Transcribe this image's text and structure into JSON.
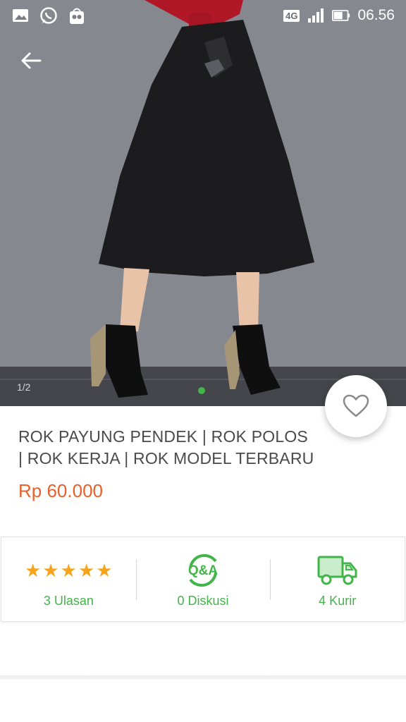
{
  "status_bar": {
    "time": "06.56",
    "network": "4G",
    "icons": [
      "gallery-icon",
      "whatsapp-icon",
      "tokopedia-icon",
      "signal-icon",
      "battery-icon"
    ]
  },
  "gallery": {
    "counter": "1/2",
    "active_dot_color": "#42b549"
  },
  "product": {
    "title": "ROK PAYUNG PENDEK | ROK POLOS | ROK KERJA | ROK MODEL TERBARU",
    "price": "Rp 60.000",
    "price_color": "#e8602a"
  },
  "stats": {
    "rating_stars": 5,
    "reviews_label": "3 Ulasan",
    "discussion_label": "0 Diskusi",
    "courier_label": "4 Kurir",
    "accent_color": "#42b549",
    "star_color": "#f7a41d"
  }
}
